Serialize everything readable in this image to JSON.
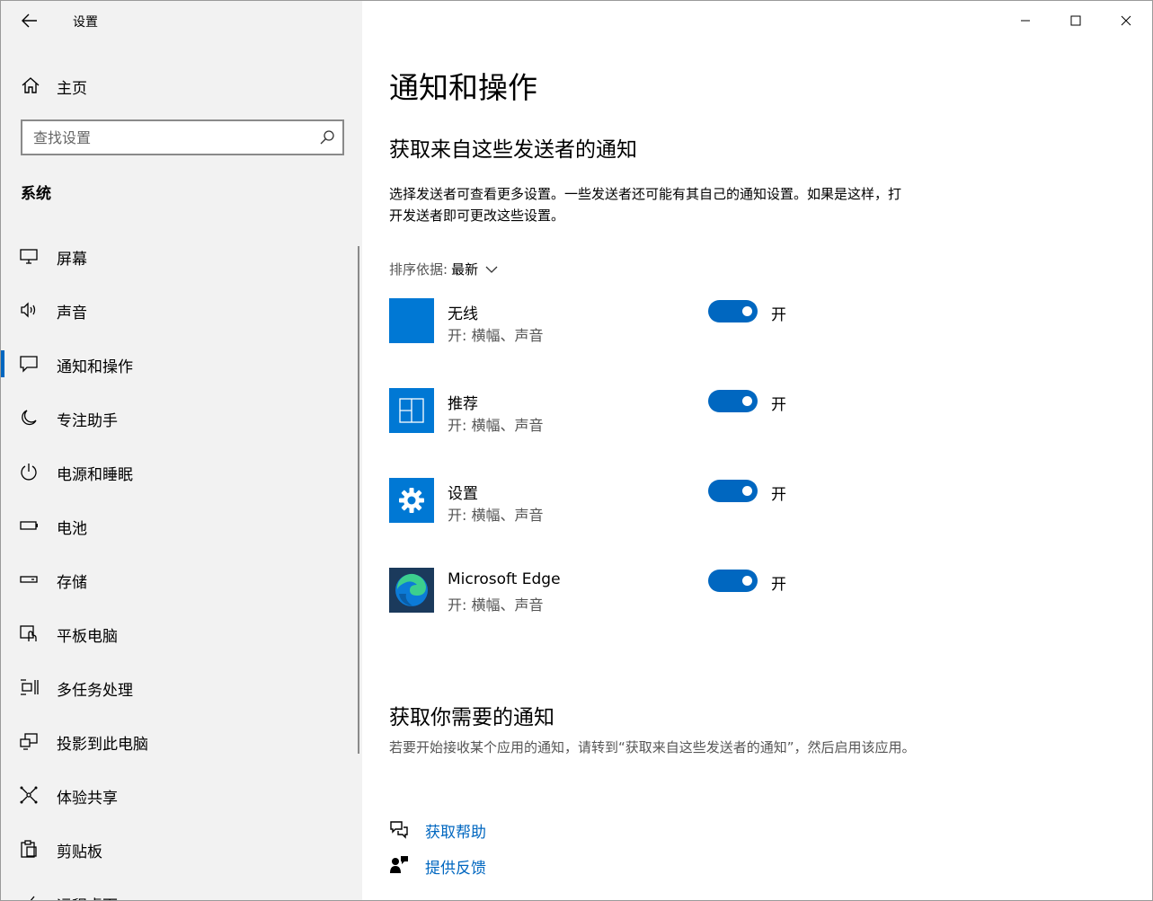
{
  "window": {
    "title": "设置",
    "controls": {
      "minimize": "minimize",
      "maximize": "maximize",
      "close": "close"
    }
  },
  "sidebar": {
    "home_label": "主页",
    "search_placeholder": "查找设置",
    "section_label": "系统",
    "items": [
      {
        "label": "屏幕",
        "icon": "monitor-icon",
        "active": false
      },
      {
        "label": "声音",
        "icon": "speaker-icon",
        "active": false
      },
      {
        "label": "通知和操作",
        "icon": "message-icon",
        "active": true
      },
      {
        "label": "专注助手",
        "icon": "moon-icon",
        "active": false
      },
      {
        "label": "电源和睡眠",
        "icon": "power-icon",
        "active": false
      },
      {
        "label": "电池",
        "icon": "battery-icon",
        "active": false
      },
      {
        "label": "存储",
        "icon": "storage-icon",
        "active": false
      },
      {
        "label": "平板电脑",
        "icon": "tablet-icon",
        "active": false
      },
      {
        "label": "多任务处理",
        "icon": "multitask-icon",
        "active": false
      },
      {
        "label": "投影到此电脑",
        "icon": "project-icon",
        "active": false
      },
      {
        "label": "体验共享",
        "icon": "share-icon",
        "active": false
      },
      {
        "label": "剪贴板",
        "icon": "clipboard-icon",
        "active": false
      },
      {
        "label": "远程桌面",
        "icon": "remote-icon",
        "active": false
      }
    ]
  },
  "main": {
    "page_title": "通知和操作",
    "section1_title": "获取来自这些发送者的通知",
    "section1_desc": "选择发送者可查看更多设置。一些发送者还可能有其自己的通知设置。如果是这样，打开发送者即可更改这些设置。",
    "sort_label": "排序依据:",
    "sort_value": "最新",
    "apps": [
      {
        "name": "无线",
        "sub": "开: 横幅、声音",
        "toggle_label": "开",
        "on": true,
        "icon": "wireless-app-icon",
        "icon_color": "#0078d4"
      },
      {
        "name": "推荐",
        "sub": "开: 横幅、声音",
        "toggle_label": "开",
        "on": true,
        "icon": "suggested-app-icon",
        "icon_color": "#0078d4"
      },
      {
        "name": "设置",
        "sub": "开: 横幅、声音",
        "toggle_label": "开",
        "on": true,
        "icon": "settings-gear-icon",
        "icon_color": "#0078d4"
      },
      {
        "name": "Microsoft Edge",
        "sub": "开: 横幅、声音",
        "toggle_label": "开",
        "on": true,
        "icon": "edge-logo-icon",
        "icon_color": "#1b3a5c"
      }
    ],
    "section2_title": "获取你需要的通知",
    "section2_desc": "若要开始接收某个应用的通知，请转到“获取来自这些发送者的通知”，然后启用该应用。",
    "links": [
      {
        "label": "获取帮助",
        "icon": "help-chat-icon"
      },
      {
        "label": "提供反馈",
        "icon": "feedback-icon"
      }
    ]
  },
  "colors": {
    "accent": "#0067c0",
    "sidebar_bg": "#f2f2f2",
    "app_tile": "#0078d4"
  }
}
